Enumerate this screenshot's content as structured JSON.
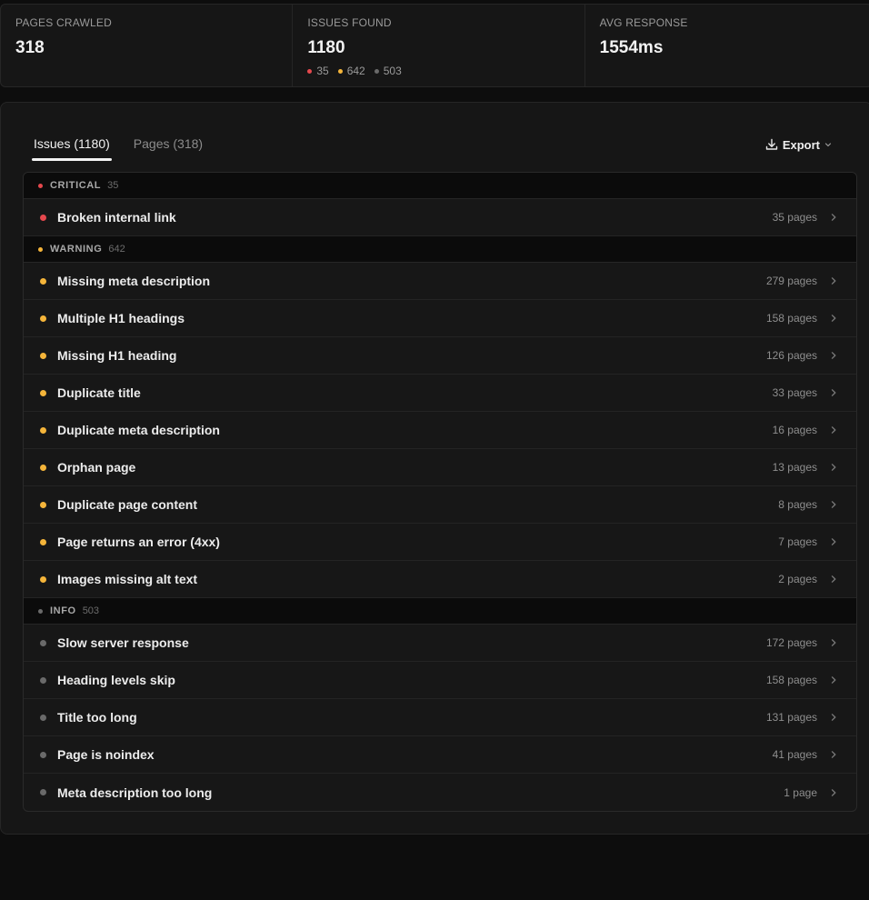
{
  "stats": {
    "pages_crawled": {
      "label": "PAGES CRAWLED",
      "value": "318"
    },
    "issues_found": {
      "label": "ISSUES FOUND",
      "value": "1180",
      "critical": "35",
      "warning": "642",
      "info": "503"
    },
    "avg_response": {
      "label": "AVG RESPONSE",
      "value": "1554ms"
    }
  },
  "tabs": [
    {
      "label": "Issues (1180)",
      "active": true
    },
    {
      "label": "Pages (318)",
      "active": false
    }
  ],
  "export_label": "Export",
  "colors": {
    "critical": "#e5484d",
    "warning": "#f5b53a",
    "info": "#6a6a6a"
  },
  "groups": [
    {
      "name": "CRITICAL",
      "count": "35",
      "items": [
        {
          "title": "Broken internal link",
          "pages": "35 pages"
        }
      ]
    },
    {
      "name": "WARNING",
      "count": "642",
      "items": [
        {
          "title": "Missing meta description",
          "pages": "279 pages"
        },
        {
          "title": "Multiple H1 headings",
          "pages": "158 pages"
        },
        {
          "title": "Missing H1 heading",
          "pages": "126 pages"
        },
        {
          "title": "Duplicate title",
          "pages": "33 pages"
        },
        {
          "title": "Duplicate meta description",
          "pages": "16 pages"
        },
        {
          "title": "Orphan page",
          "pages": "13 pages"
        },
        {
          "title": "Duplicate page content",
          "pages": "8 pages"
        },
        {
          "title": "Page returns an error (4xx)",
          "pages": "7 pages"
        },
        {
          "title": "Images missing alt text",
          "pages": "2 pages"
        }
      ]
    },
    {
      "name": "INFO",
      "count": "503",
      "items": [
        {
          "title": "Slow server response",
          "pages": "172 pages"
        },
        {
          "title": "Heading levels skip",
          "pages": "158 pages"
        },
        {
          "title": "Title too long",
          "pages": "131 pages"
        },
        {
          "title": "Page is noindex",
          "pages": "41 pages"
        },
        {
          "title": "Meta description too long",
          "pages": "1 page"
        }
      ]
    }
  ]
}
